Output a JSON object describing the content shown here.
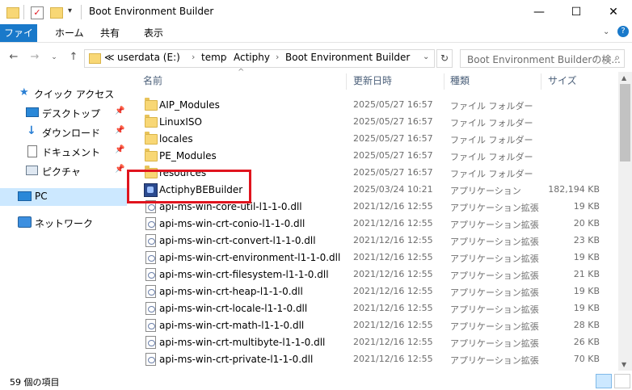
{
  "window": {
    "title": "Boot Environment Builder",
    "minimize": "—",
    "maximize": "☐",
    "close": "✕"
  },
  "ribbon": {
    "tabs": [
      "ファイル",
      "ホーム",
      "共有",
      "表示"
    ]
  },
  "address": {
    "segments": [
      "≪",
      "userdata (E:)",
      "temp",
      "Actiphy",
      "Boot Environment Builder"
    ],
    "search_placeholder": "Boot Environment Builderの検..."
  },
  "nav": {
    "items": [
      {
        "label": "クイック アクセス",
        "icon": "star-icon"
      },
      {
        "label": "デスクトップ",
        "icon": "desktop-icon",
        "pinned": true
      },
      {
        "label": "ダウンロード",
        "icon": "download-icon",
        "pinned": true
      },
      {
        "label": "ドキュメント",
        "icon": "document-icon",
        "pinned": true
      },
      {
        "label": "ピクチャ",
        "icon": "picture-icon",
        "pinned": true
      },
      {
        "label": "PC",
        "icon": "pc-icon",
        "selected": true
      },
      {
        "label": "ネットワーク",
        "icon": "network-icon"
      }
    ]
  },
  "columns": {
    "name": "名前",
    "date": "更新日時",
    "type": "種類",
    "size": "サイズ"
  },
  "files": [
    {
      "name": "AIP_Modules",
      "date": "2025/05/27 16:57",
      "type": "ファイル フォルダー",
      "size": "",
      "kind": "folder"
    },
    {
      "name": "LinuxISO",
      "date": "2025/05/27 16:57",
      "type": "ファイル フォルダー",
      "size": "",
      "kind": "folder"
    },
    {
      "name": "locales",
      "date": "2025/05/27 16:57",
      "type": "ファイル フォルダー",
      "size": "",
      "kind": "folder"
    },
    {
      "name": "PE_Modules",
      "date": "2025/05/27 16:57",
      "type": "ファイル フォルダー",
      "size": "",
      "kind": "folder"
    },
    {
      "name": "resources",
      "date": "2025/05/27 16:57",
      "type": "ファイル フォルダー",
      "size": "",
      "kind": "folder"
    },
    {
      "name": "ActiphyBEBuilder",
      "date": "2025/03/24 10:21",
      "type": "アプリケーション",
      "size": "182,194 KB",
      "kind": "exe"
    },
    {
      "name": "api-ms-win-core-util-l1-1-0.dll",
      "date": "2021/12/16 12:55",
      "type": "アプリケーション拡張",
      "size": "19 KB",
      "kind": "dll"
    },
    {
      "name": "api-ms-win-crt-conio-l1-1-0.dll",
      "date": "2021/12/16 12:55",
      "type": "アプリケーション拡張",
      "size": "20 KB",
      "kind": "dll"
    },
    {
      "name": "api-ms-win-crt-convert-l1-1-0.dll",
      "date": "2021/12/16 12:55",
      "type": "アプリケーション拡張",
      "size": "23 KB",
      "kind": "dll"
    },
    {
      "name": "api-ms-win-crt-environment-l1-1-0.dll",
      "date": "2021/12/16 12:55",
      "type": "アプリケーション拡張",
      "size": "19 KB",
      "kind": "dll"
    },
    {
      "name": "api-ms-win-crt-filesystem-l1-1-0.dll",
      "date": "2021/12/16 12:55",
      "type": "アプリケーション拡張",
      "size": "21 KB",
      "kind": "dll"
    },
    {
      "name": "api-ms-win-crt-heap-l1-1-0.dll",
      "date": "2021/12/16 12:55",
      "type": "アプリケーション拡張",
      "size": "19 KB",
      "kind": "dll"
    },
    {
      "name": "api-ms-win-crt-locale-l1-1-0.dll",
      "date": "2021/12/16 12:55",
      "type": "アプリケーション拡張",
      "size": "19 KB",
      "kind": "dll"
    },
    {
      "name": "api-ms-win-crt-math-l1-1-0.dll",
      "date": "2021/12/16 12:55",
      "type": "アプリケーション拡張",
      "size": "28 KB",
      "kind": "dll"
    },
    {
      "name": "api-ms-win-crt-multibyte-l1-1-0.dll",
      "date": "2021/12/16 12:55",
      "type": "アプリケーション拡張",
      "size": "26 KB",
      "kind": "dll"
    },
    {
      "name": "api-ms-win-crt-private-l1-1-0.dll",
      "date": "2021/12/16 12:55",
      "type": "アプリケーション拡張",
      "size": "70 KB",
      "kind": "dll"
    }
  ],
  "status": {
    "item_count": "59 個の項目"
  },
  "colors": {
    "accent": "#1979ca",
    "highlight_border": "#e0141e",
    "selected_nav": "#cce8ff"
  }
}
